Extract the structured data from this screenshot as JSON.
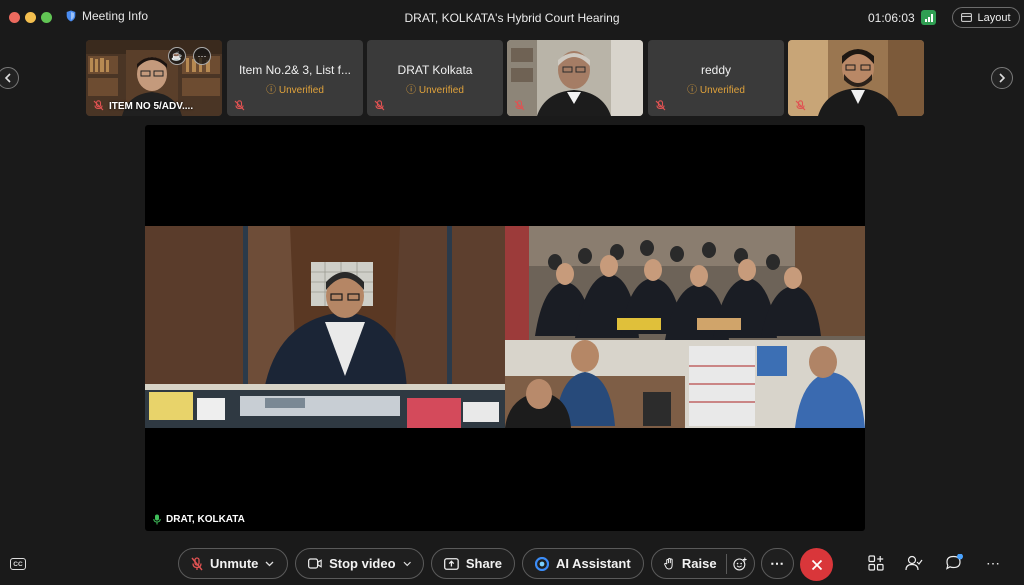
{
  "window": {
    "title": "DRAT, KOLKATA's Hybrid Court Hearing",
    "meeting_info_label": "Meeting Info",
    "timer": "01:06:03",
    "layout_label": "Layout",
    "traffic_lights": [
      "#ec6a5e",
      "#f4bf4f",
      "#61c554"
    ]
  },
  "participants": [
    {
      "name": "ITEM NO 5/ADV....",
      "has_video": true,
      "muted": true
    },
    {
      "name": "Item No.2& 3, List f...",
      "status": "Unverified",
      "has_video": false,
      "muted": true
    },
    {
      "name": "DRAT Kolkata",
      "status": "Unverified",
      "has_video": false,
      "muted": true
    },
    {
      "name": "",
      "has_video": true,
      "muted": true
    },
    {
      "name": "reddy",
      "status": "Unverified",
      "has_video": false,
      "muted": true
    },
    {
      "name": "",
      "has_video": true,
      "muted": true
    }
  ],
  "stage": {
    "speaker_label": "DRAT, KOLKATA"
  },
  "toolbar": {
    "unmute_label": "Unmute",
    "stop_video_label": "Stop video",
    "share_label": "Share",
    "ai_assistant_label": "AI Assistant",
    "raise_label": "Raise",
    "cc_label": "CC"
  },
  "colors": {
    "background": "#1a1a1a",
    "tile": "#3a3a3a",
    "unverified": "#e0a23b",
    "muted_icon": "#e05252",
    "end_call": "#d9363a",
    "signal": "#2f9e52"
  }
}
